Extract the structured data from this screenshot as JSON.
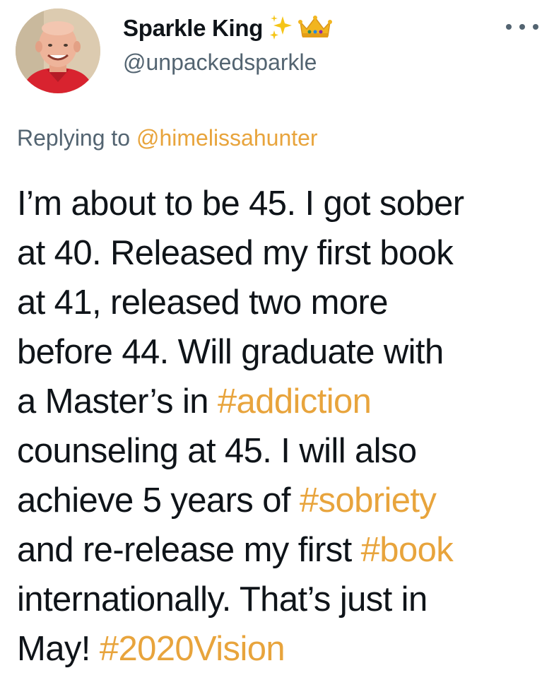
{
  "author": {
    "display_name": "Sparkle King",
    "emoji": [
      "sparkles",
      "crown"
    ],
    "handle": "@unpackedsparkle"
  },
  "reply": {
    "prefix": "Replying to",
    "mention": "@himelissahunter"
  },
  "tweet": {
    "lines": [
      {
        "text": "I’m about to be 45. I got sober",
        "hashtag": "",
        "after": ""
      },
      {
        "text": "at 40. Released my first book",
        "hashtag": "",
        "after": ""
      },
      {
        "text": "at 41, released two more",
        "hashtag": "",
        "after": ""
      },
      {
        "text": "before 44. Will graduate with",
        "hashtag": "",
        "after": ""
      },
      {
        "text": "a Master’s in ",
        "hashtag": "#addiction",
        "after": ""
      },
      {
        "text": "counseling at 45. I will also",
        "hashtag": "",
        "after": ""
      },
      {
        "text": "achieve 5 years of ",
        "hashtag": "#sobriety",
        "after": ""
      },
      {
        "text": "and re-release my first ",
        "hashtag": "#book",
        "after": ""
      },
      {
        "text": "internationally. That’s just in",
        "hashtag": "",
        "after": ""
      },
      {
        "text": "May! ",
        "hashtag": "#2020Vision",
        "after": ""
      }
    ]
  },
  "colors": {
    "hashtag": "#e8a43c",
    "secondary_text": "#536471",
    "primary_text": "#0f1419"
  },
  "icons": {
    "more": "more-horizontal-icon"
  }
}
